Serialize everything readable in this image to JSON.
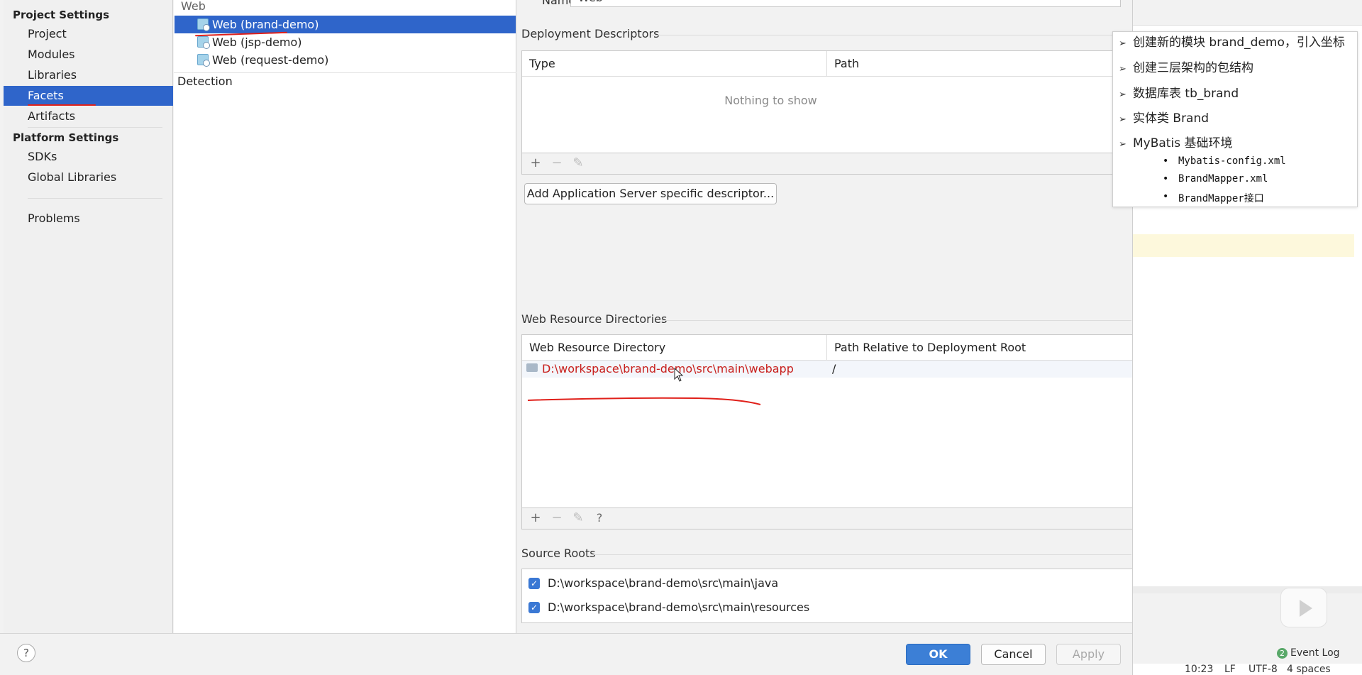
{
  "sidebar": {
    "project_settings_header": "Project Settings",
    "project_items": [
      "Project",
      "Modules",
      "Libraries",
      "Facets",
      "Artifacts"
    ],
    "platform_settings_header": "Platform Settings",
    "platform_items": [
      "SDKs",
      "Global Libraries"
    ],
    "problems_label": "Problems",
    "selected": "Facets"
  },
  "tree": {
    "root_label": "Web",
    "items": [
      "Web (brand-demo)",
      "Web (jsp-demo)",
      "Web (request-demo)"
    ],
    "selected": "Web (brand-demo)",
    "detection_label": "Detection"
  },
  "main": {
    "name_label": "Name:",
    "name_value": "Web",
    "deployment_descriptors": {
      "title": "Deployment Descriptors",
      "columns": [
        "Type",
        "Path"
      ],
      "empty_text": "Nothing to show",
      "add_server_button": "Add Application Server specific descriptor..."
    },
    "web_resource_directories": {
      "title": "Web Resource Directories",
      "columns": [
        "Web Resource Directory",
        "Path Relative to Deployment Root"
      ],
      "rows": [
        {
          "directory": "D:\\workspace\\brand-demo\\src\\main\\webapp",
          "path": "/"
        }
      ]
    },
    "source_roots": {
      "title": "Source Roots",
      "items": [
        {
          "path": "D:\\workspace\\brand-demo\\src\\main\\java",
          "checked": true
        },
        {
          "path": "D:\\workspace\\brand-demo\\src\\main\\resources",
          "checked": true
        }
      ]
    }
  },
  "footer": {
    "help": "?",
    "ok": "OK",
    "cancel": "Cancel",
    "apply": "Apply"
  },
  "outline": {
    "items": [
      "创建新的模块 brand_demo，引入坐标",
      "创建三层架构的包结构",
      "数据库表 tb_brand",
      "实体类 Brand",
      "MyBatis 基础环境"
    ],
    "sub_items": [
      "Mybatis-config.xml",
      "BrandMapper.xml",
      "BrandMapper接口"
    ]
  },
  "statusbar": {
    "event_log_count": "2",
    "event_log": "Event Log",
    "time": "10:23",
    "line_sep": "LF",
    "encoding": "UTF-8",
    "indent": "4 spaces"
  },
  "colors": {
    "selection": "#2f65ca",
    "error_path": "#c8201d",
    "annotation": "#e0201a"
  }
}
